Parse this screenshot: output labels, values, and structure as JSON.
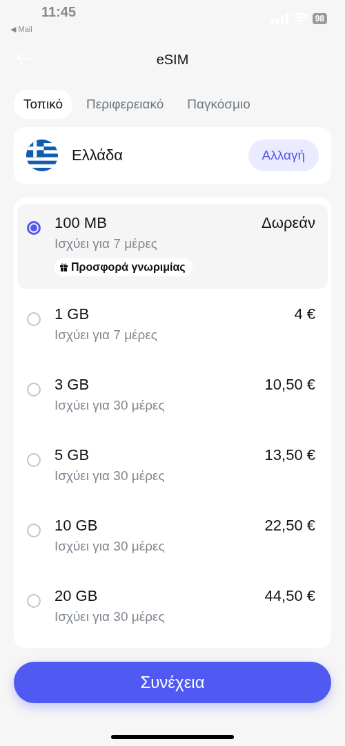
{
  "status_bar": {
    "time": "11:45",
    "back_app": "◀ Mail",
    "battery": "98"
  },
  "header": {
    "title": "eSIM"
  },
  "tabs": [
    {
      "label": "Τοπικό",
      "selected": true
    },
    {
      "label": "Περιφερειακό",
      "selected": false
    },
    {
      "label": "Παγκόσμιο",
      "selected": false
    }
  ],
  "country": {
    "name": "Ελλάδα",
    "button": "Αλλαγή"
  },
  "plans": [
    {
      "data": "100 MB",
      "validity": "Ισχύει για 7 μέρες",
      "price": "Δωρεάν",
      "selected": true,
      "badge": "Προσφορά γνωριμίας"
    },
    {
      "data": "1 GB",
      "validity": "Ισχύει για 7 μέρες",
      "price": "4 €",
      "selected": false
    },
    {
      "data": "3 GB",
      "validity": "Ισχύει για 30 μέρες",
      "price": "10,50 €",
      "selected": false
    },
    {
      "data": "5 GB",
      "validity": "Ισχύει για 30 μέρες",
      "price": "13,50 €",
      "selected": false
    },
    {
      "data": "10 GB",
      "validity": "Ισχύει για 30 μέρες",
      "price": "22,50 €",
      "selected": false
    },
    {
      "data": "20 GB",
      "validity": "Ισχύει για 30 μέρες",
      "price": "44,50 €",
      "selected": false
    }
  ],
  "continue_button": "Συνέχεια"
}
